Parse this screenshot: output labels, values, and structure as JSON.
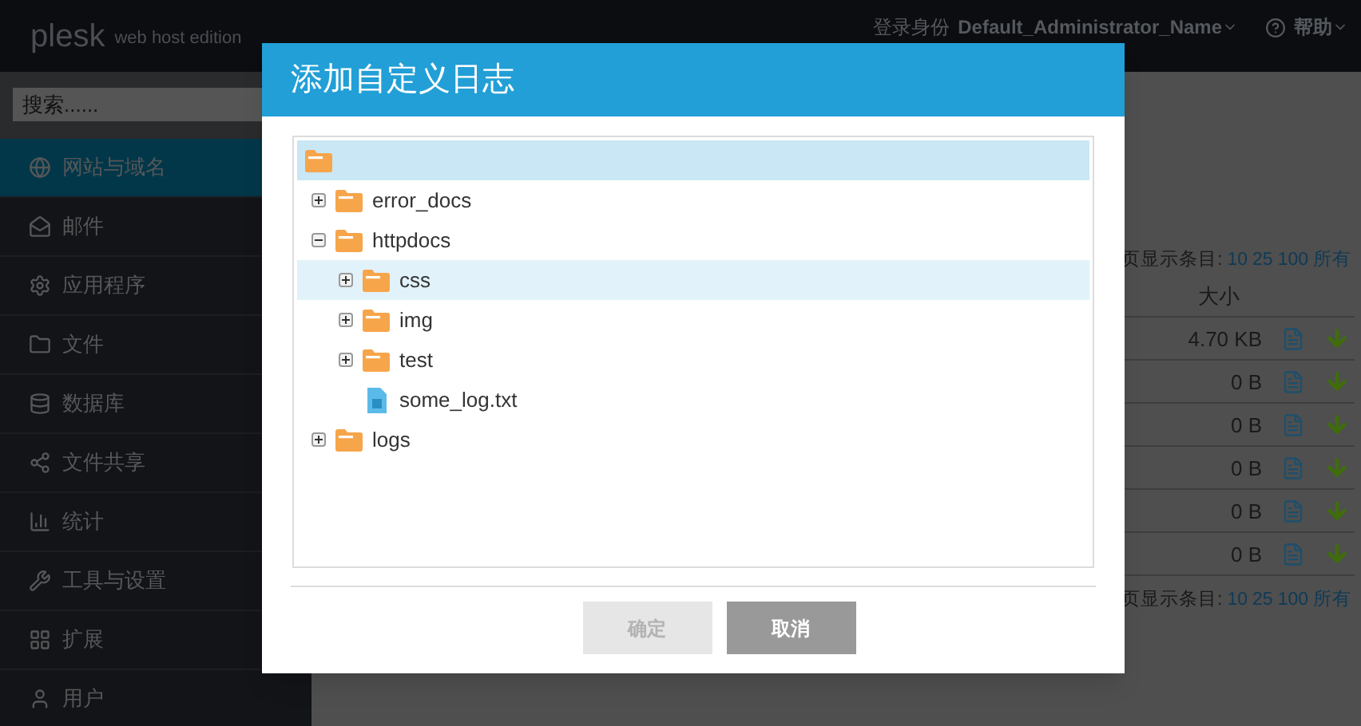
{
  "header": {
    "logo": "plesk",
    "edition": "web host edition",
    "login_label": "登录身份",
    "user": "Default_Administrator_Name",
    "help": "帮助"
  },
  "sidebar": {
    "search": {
      "placeholder": "搜索......"
    },
    "items": [
      {
        "label": "网站与域名",
        "selected": true
      },
      {
        "label": "邮件",
        "selected": false
      },
      {
        "label": "应用程序",
        "selected": false
      },
      {
        "label": "文件",
        "selected": false
      },
      {
        "label": "数据库",
        "selected": false
      },
      {
        "label": "文件共享",
        "selected": false
      },
      {
        "label": "统计",
        "selected": false
      },
      {
        "label": "工具与设置",
        "selected": false
      },
      {
        "label": "扩展",
        "selected": false
      },
      {
        "label": "用户",
        "selected": false
      }
    ]
  },
  "main": {
    "pager_top": {
      "label": "页显示条目:",
      "options": [
        "10",
        "25",
        "100",
        "所有"
      ]
    },
    "table": {
      "size_header": "大小",
      "rows": [
        {
          "size": "4.70 KB"
        },
        {
          "size": "0 B"
        },
        {
          "size": "0 B"
        },
        {
          "size": "0 B"
        },
        {
          "size": "0 B"
        },
        {
          "size": "0 B"
        }
      ]
    },
    "pager_bottom": {
      "label": "页显示条目:",
      "options": [
        "10",
        "25",
        "100",
        "所有"
      ]
    }
  },
  "dialog": {
    "title": "添加自定义日志",
    "tree": {
      "kind": "folder",
      "selected": true,
      "children": [
        {
          "kind": "folder",
          "name": "error_docs",
          "selected": false,
          "hovered": false,
          "expanded": false
        },
        {
          "kind": "folder",
          "name": "httpdocs",
          "selected": false,
          "hovered": false,
          "expanded": true,
          "children": [
            {
              "kind": "folder",
              "name": "css",
              "selected": false,
              "hovered": true,
              "expanded": false
            },
            {
              "kind": "folder",
              "name": "img",
              "selected": false,
              "hovered": false,
              "expanded": false
            },
            {
              "kind": "folder",
              "name": "test",
              "selected": false,
              "hovered": false,
              "expanded": false
            },
            {
              "kind": "file",
              "name": "some_log.txt",
              "selected": false,
              "hovered": false
            }
          ]
        },
        {
          "kind": "folder",
          "name": "logs",
          "selected": false,
          "hovered": false,
          "expanded": false
        }
      ]
    },
    "buttons": [
      {
        "label": "确定",
        "disabled": true
      },
      {
        "label": "取消",
        "disabled": false
      }
    ]
  }
}
